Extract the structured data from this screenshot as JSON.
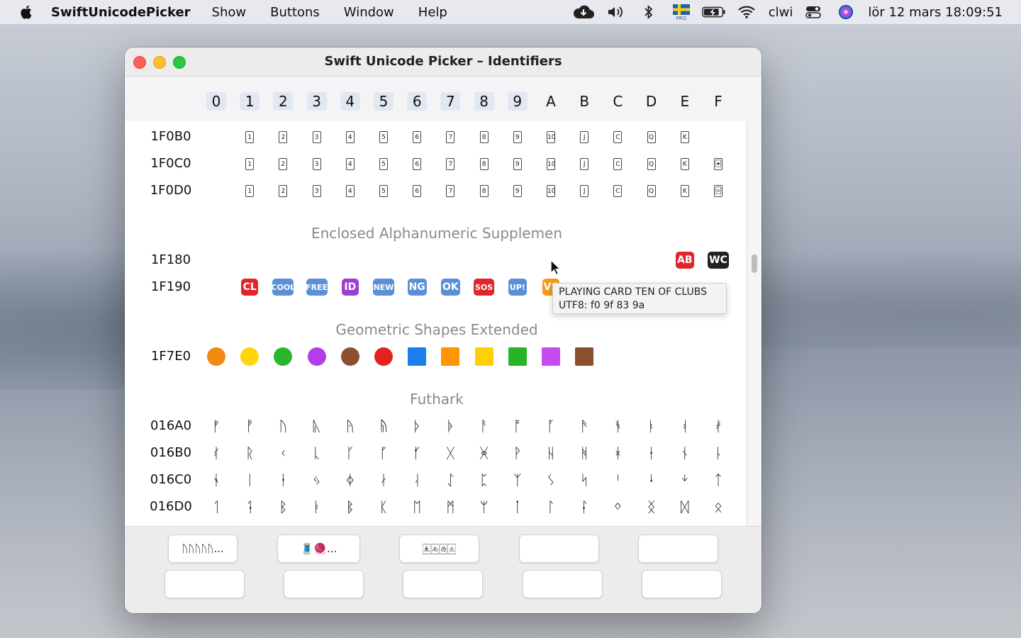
{
  "menubar": {
    "app_name": "SwiftUnicodePicker",
    "menus": [
      "Show",
      "Buttons",
      "Window",
      "Help"
    ],
    "user": "clwi",
    "datetime": "lör 12 mars  18:09:51",
    "status_icons": [
      "cloud-icon",
      "volume-icon",
      "bluetooth-icon",
      "swedish-flag-pro-icon",
      "battery-icon",
      "wifi-icon",
      "control-center-icon",
      "siri-icon"
    ]
  },
  "window": {
    "title": "Swift Unicode Picker – Identifiers"
  },
  "columns": [
    "0",
    "1",
    "2",
    "3",
    "4",
    "5",
    "6",
    "7",
    "8",
    "9",
    "A",
    "B",
    "C",
    "D",
    "E",
    "F"
  ],
  "blocks": {
    "cards": {
      "rows": [
        {
          "label": "1F0B0",
          "cells": [
            "",
            "1",
            "2",
            "3",
            "4",
            "5",
            "6",
            "7",
            "8",
            "9",
            "10",
            "J",
            "C",
            "Q",
            "K",
            ""
          ]
        },
        {
          "label": "1F0C0",
          "cells": [
            "",
            "1",
            "2",
            "3",
            "4",
            "5",
            "6",
            "7",
            "8",
            "9",
            "10",
            "J",
            "C",
            "Q",
            "K",
            "🃏"
          ]
        },
        {
          "label": "1F0D0",
          "cells": [
            "",
            "1",
            "2",
            "3",
            "4",
            "5",
            "6",
            "7",
            "8",
            "9",
            "10",
            "J",
            "C",
            "Q",
            "K",
            "🃟"
          ]
        }
      ]
    },
    "enclosed": {
      "title": "Enclosed Alphanumeric Supplemen",
      "rows": [
        {
          "label": "1F180",
          "cells": [
            "",
            "",
            "",
            "",
            "",
            "",
            "",
            "",
            "",
            "",
            "",
            "",
            "",
            "",
            "AB",
            "WC"
          ]
        },
        {
          "label": "1F190",
          "cells": [
            "",
            "CL",
            "COOL",
            "FREE",
            "ID",
            "NEW",
            "NG",
            "OK",
            "SOS",
            "UP!",
            "VS",
            "",
            "",
            "",
            "",
            ""
          ]
        }
      ]
    },
    "geometric": {
      "title": "Geometric Shapes Extended",
      "row": {
        "label": "1F7E0"
      },
      "colors": [
        "#f08a12",
        "#ffd60a",
        "#2ab52a",
        "#b23ee8",
        "#8b5030",
        "#e3221c",
        "#1e7ef0",
        "#ff9500",
        "#ffd00a",
        "#26b526",
        "#c64cf0",
        "#8b5030"
      ]
    },
    "futhark": {
      "title": "Futhark",
      "rows": [
        {
          "label": "016A0",
          "cells": [
            "ᚠ",
            "ᚡ",
            "ᚢ",
            "ᚣ",
            "ᚤ",
            "ᚥ",
            "ᚦ",
            "ᚧ",
            "ᚨ",
            "ᚩ",
            "ᚪ",
            "ᚫ",
            "ᚬ",
            "ᚭ",
            "ᚮ",
            "ᚯ"
          ]
        },
        {
          "label": "016B0",
          "cells": [
            "ᚰ",
            "ᚱ",
            "ᚲ",
            "ᚳ",
            "ᚴ",
            "ᚵ",
            "ᚶ",
            "ᚷ",
            "ᚸ",
            "ᚹ",
            "ᚺ",
            "ᚻ",
            "ᚼ",
            "ᚽ",
            "ᚾ",
            "ᚿ"
          ]
        },
        {
          "label": "016C0",
          "cells": [
            "ᛀ",
            "ᛁ",
            "ᛂ",
            "ᛃ",
            "ᛄ",
            "ᛅ",
            "ᛆ",
            "ᛇ",
            "ᛈ",
            "ᛉ",
            "ᛊ",
            "ᛋ",
            "ᛌ",
            "ᛍ",
            "ᛎ",
            "ᛏ"
          ]
        },
        {
          "label": "016D0",
          "cells": [
            "ᛐ",
            "ᛑ",
            "ᛒ",
            "ᛓ",
            "ᛔ",
            "ᛕ",
            "ᛖ",
            "ᛗ",
            "ᛘ",
            "ᛙ",
            "ᛚ",
            "ᛛ",
            "ᛜ",
            "ᛝ",
            "ᛞ",
            "ᛟ"
          ]
        }
      ]
    }
  },
  "tooltip": {
    "line1": "PLAYING CARD TEN OF CLUBS",
    "line2": "UTF8: f0 9f 83 9a"
  },
  "buttons": {
    "b1": "ᚢᚢᚢᚢᚢ...",
    "b2": "🧵🧶...",
    "b3": "🀀🀁🀂🀃"
  }
}
